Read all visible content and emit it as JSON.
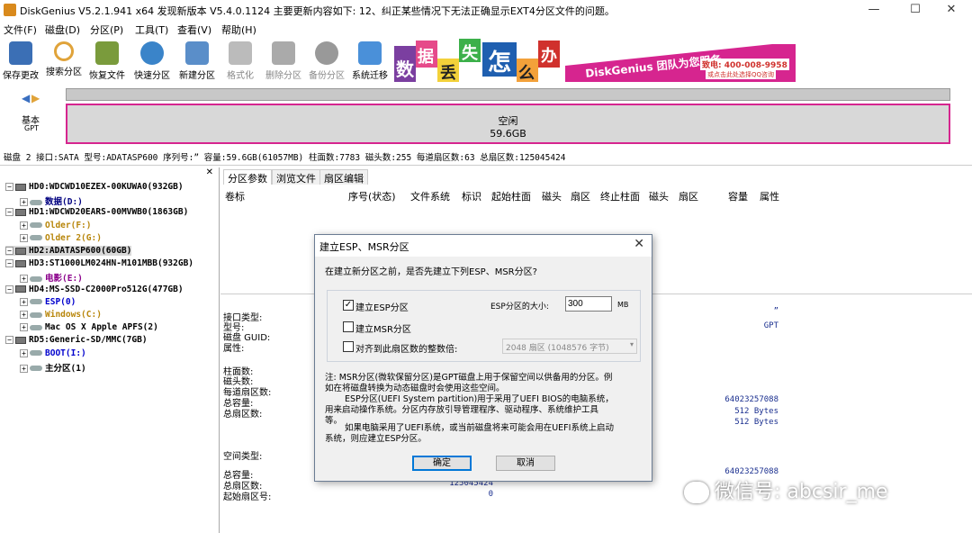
{
  "window": {
    "title": "DiskGenius V5.2.1.941 x64  发现新版本 V5.4.0.1124 主要更新内容如下: 12、纠正某些情况下无法正确显示EXT4分区文件的问题。",
    "min": "—",
    "max": "☐",
    "close": "✕"
  },
  "menu": [
    "文件(F)",
    "磁盘(D)",
    "分区(P)",
    "工具(T)",
    "查看(V)",
    "帮助(H)"
  ],
  "toolbar": [
    {
      "label": "保存更改",
      "icon": "save-icon",
      "color": "#3b6fb5",
      "enabled": true
    },
    {
      "label": "搜索分区",
      "icon": "search-icon",
      "color": "#e0a33a",
      "enabled": true
    },
    {
      "label": "恢复文件",
      "icon": "recover-icon",
      "color": "#7a9b3c",
      "enabled": true
    },
    {
      "label": "快速分区",
      "icon": "quick-partition-icon",
      "color": "#3a84c9",
      "enabled": true
    },
    {
      "label": "新建分区",
      "icon": "new-partition-icon",
      "color": "#5a8ec9",
      "enabled": true
    },
    {
      "label": "格式化",
      "icon": "format-icon",
      "color": "#9a9a9a",
      "enabled": false
    },
    {
      "label": "删除分区",
      "icon": "delete-icon",
      "color": "#9a9a9a",
      "enabled": false
    },
    {
      "label": "备份分区",
      "icon": "backup-icon",
      "color": "#9a9a9a",
      "enabled": false
    },
    {
      "label": "系统迁移",
      "icon": "migrate-icon",
      "color": "#4a90d9",
      "enabled": true
    }
  ],
  "banner": {
    "chars": [
      "数",
      "据",
      "丢",
      "失",
      "怎",
      "么",
      "办"
    ],
    "brand": "DiskGenius 团队为您服务",
    "phone": "致电: 400-008-9958",
    "qq": "或点击此处选择QQ咨询"
  },
  "diskbar": {
    "type": "基本",
    "subtype": "GPT",
    "space_label": "空闲",
    "space_size": "59.6GB"
  },
  "disk_info": "磁盘 2 接口:SATA  型号:ADATASP600  序列号:”  容量:59.6GB(61057MB)  柱面数:7783  磁头数:255  每道扇区数:63  总扇区数:125045424",
  "tree": [
    {
      "text": "HD0:WDCWD10EZEX-00KUWA0(932GB)",
      "level": 0,
      "kind": "disk",
      "color": "#000"
    },
    {
      "text": "数据(D:)",
      "level": 1,
      "kind": "part",
      "color": "#000080"
    },
    {
      "text": "HD1:WDCWD20EARS-00MVWB0(1863GB)",
      "level": 0,
      "kind": "disk",
      "color": "#000"
    },
    {
      "text": "Older(F:)",
      "level": 1,
      "kind": "part",
      "color": "#b8860b"
    },
    {
      "text": "Older 2(G:)",
      "level": 1,
      "kind": "part",
      "color": "#b8860b"
    },
    {
      "text": "HD2:ADATASP600(60GB)",
      "level": 0,
      "kind": "disk",
      "color": "#000",
      "selected": true
    },
    {
      "text": "HD3:ST1000LM024HN-M101MBB(932GB)",
      "level": 0,
      "kind": "disk",
      "color": "#000"
    },
    {
      "text": "电影(E:)",
      "level": 1,
      "kind": "part",
      "color": "#8b008b"
    },
    {
      "text": "HD4:MS-SSD-C2000Pro512G(477GB)",
      "level": 0,
      "kind": "disk",
      "color": "#000"
    },
    {
      "text": "ESP(0)",
      "level": 1,
      "kind": "part",
      "color": "#0000cd"
    },
    {
      "text": "Windows(C:)",
      "level": 1,
      "kind": "part",
      "color": "#b8860b"
    },
    {
      "text": "Mac OS X Apple APFS(2)",
      "level": 1,
      "kind": "part",
      "color": "#000"
    },
    {
      "text": "RD5:Generic-SD/MMC(7GB)",
      "level": 0,
      "kind": "disk",
      "color": "#000"
    },
    {
      "text": "BOOT(I:)",
      "level": 1,
      "kind": "part",
      "color": "#0000cd"
    },
    {
      "text": "主分区(1)",
      "level": 1,
      "kind": "part",
      "color": "#000"
    }
  ],
  "tabs": [
    "分区参数",
    "浏览文件",
    "扇区编辑"
  ],
  "columns": [
    "卷标",
    "序号(状态)",
    "文件系统",
    "标识",
    "起始柱面",
    "磁头",
    "扇区",
    "终止柱面",
    "磁头",
    "扇区",
    "容量",
    "属性"
  ],
  "params": {
    "interface_type": "接口类型:",
    "model": "型号:",
    "disk_guid": "磁盘 GUID:",
    "attributes": "属性:",
    "cylinders": "柱面数:",
    "heads": "磁头数:",
    "sectors_per_track": "每道扇区数:",
    "total_capacity": "总容量:",
    "total_sectors": "总扇区数:",
    "interface_val": "”",
    "gpt": "GPT",
    "total_bytes": "64023257088",
    "sector_size1": "512 Bytes",
    "sector_size2": "512 Bytes",
    "space_type": "空间类型:",
    "total_capacity2": "总容量:",
    "total_sectors2": "总扇区数:",
    "start_sector": "起始扇区号:",
    "total_bytes2": "64023257088",
    "total_sectors_val": "125045424",
    "start_sector_val": "0"
  },
  "dialog": {
    "title": "建立ESP、MSR分区",
    "question": "在建立新分区之前，是否先建立下列ESP、MSR分区?",
    "esp_label": "建立ESP分区",
    "esp_checked": true,
    "esp_size_label": "ESP分区的大小:",
    "esp_size": "300",
    "esp_unit": "MB",
    "msr_label": "建立MSR分区",
    "msr_checked": false,
    "align_label": "对齐到此扇区数的整数倍:",
    "align_checked": false,
    "align_select": "2048 扇区 (1048576 字节)",
    "note1": "注: MSR分区(微软保留分区)是GPT磁盘上用于保留空间以供备用的分区。例",
    "note2": "如在将磁盘转换为动态磁盘时会使用这些空间。",
    "note3": "ESP分区(UEFI System partition)用于采用了UEFI BIOS的电脑系统，",
    "note4": "用来启动操作系统。分区内存放引导管理程序、驱动程序、系统维护工具",
    "note5": "等。",
    "note6": "如果电脑采用了UEFI系统，或当前磁盘将来可能会用在UEFI系统上启动",
    "note7": "系统，则应建立ESP分区。",
    "ok": "确定",
    "cancel": "取消"
  },
  "watermark": "微信号: abcsir_me"
}
